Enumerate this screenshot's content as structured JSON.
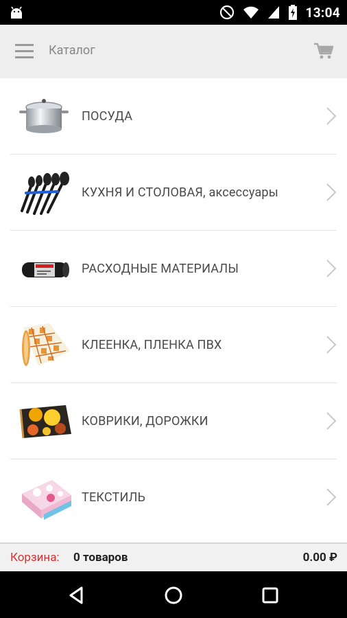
{
  "status": {
    "time": "13:04"
  },
  "appbar": {
    "title": "Каталог"
  },
  "catalog": {
    "items": [
      {
        "label": "ПОСУДА",
        "icon": "pot-image"
      },
      {
        "label": "КУХНЯ И СТОЛОВАЯ, аксессуары",
        "icon": "kitchen-utensils-image"
      },
      {
        "label": "РАСХОДНЫЕ МАТЕРИАЛЫ",
        "icon": "trash-bags-image"
      },
      {
        "label": "КЛЕЕНКА, ПЛЕНКА ПВХ",
        "icon": "oilcloth-roll-image"
      },
      {
        "label": "КОВРИКИ, ДОРОЖКИ",
        "icon": "rug-image"
      },
      {
        "label": "ТЕКСТИЛЬ",
        "icon": "towels-image"
      }
    ]
  },
  "cart": {
    "label": "Корзина:",
    "count": "0 товаров",
    "total": "0.00 ₽"
  },
  "colors": {
    "accent": "#e02b2b",
    "appbar": "#eeeeee",
    "text": "#4a4a4a"
  }
}
